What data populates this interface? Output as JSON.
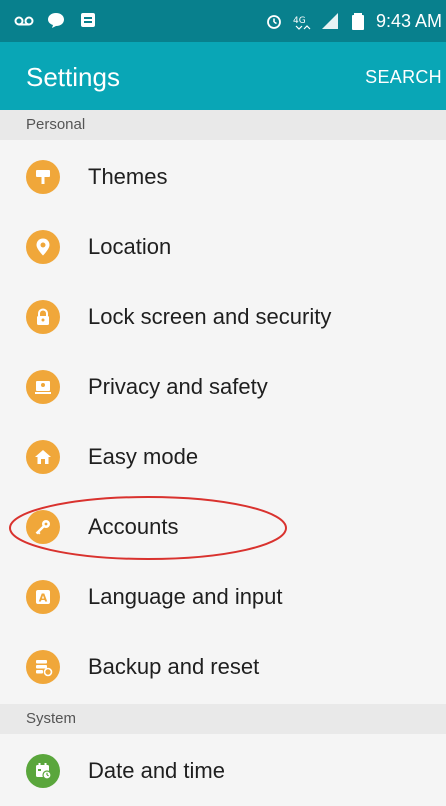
{
  "status_bar": {
    "time": "9:43 AM",
    "left_icons": [
      "voicemail-icon",
      "chat-icon",
      "notification-icon"
    ],
    "right_icons": [
      "alarm-icon",
      "4g-icon",
      "signal-icon",
      "battery-icon"
    ]
  },
  "app_bar": {
    "title": "Settings",
    "search_label": "SEARCH"
  },
  "sections": [
    {
      "header": "Personal",
      "items": [
        {
          "label": "Themes",
          "icon": "themes-icon"
        },
        {
          "label": "Location",
          "icon": "location-pin-icon"
        },
        {
          "label": "Lock screen and security",
          "icon": "lock-icon"
        },
        {
          "label": "Privacy and safety",
          "icon": "privacy-icon"
        },
        {
          "label": "Easy mode",
          "icon": "easy-mode-icon"
        },
        {
          "label": "Accounts",
          "icon": "key-icon",
          "highlighted": true
        },
        {
          "label": "Language and input",
          "icon": "language-icon"
        },
        {
          "label": "Backup and reset",
          "icon": "backup-icon"
        }
      ]
    },
    {
      "header": "System",
      "items": [
        {
          "label": "Date and time",
          "icon": "calendar-clock-icon"
        }
      ]
    }
  ],
  "colors": {
    "status_bar": "#08808d",
    "app_bar": "#09a6b6",
    "personal_icon": "#f0a73a",
    "system_icon": "#5aa63c",
    "highlight_circle": "#d9322e"
  }
}
